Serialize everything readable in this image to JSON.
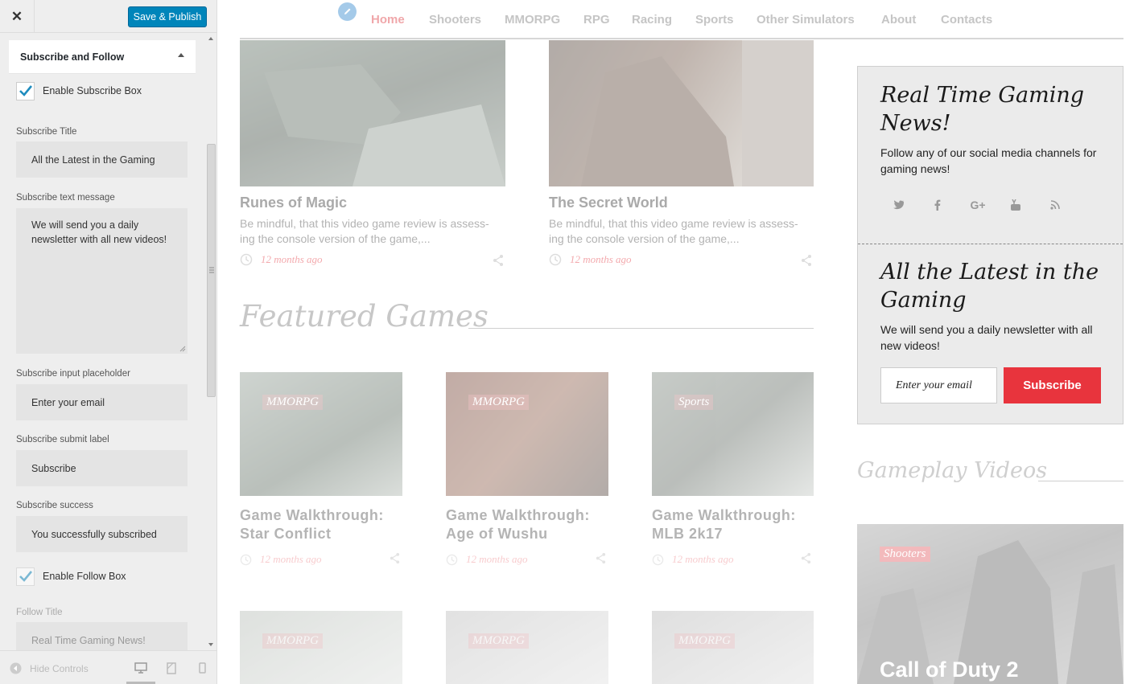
{
  "panel": {
    "close_symbol": "✕",
    "publish_label": "Save & Publish",
    "section_title": "Subscribe and Follow",
    "enable_subscribe_label": "Enable Subscribe Box",
    "enable_subscribe_checked": true,
    "fields": {
      "subscribe_title_label": "Subscribe Title",
      "subscribe_title_value": "All the Latest in the Gaming",
      "subscribe_text_label": "Subscribe text message",
      "subscribe_text_value": "We will send you a daily newsletter with all new videos!",
      "subscribe_placeholder_label": "Subscribe input placeholder",
      "subscribe_placeholder_value": "Enter your email",
      "subscribe_submit_label": "Subscribe submit label",
      "subscribe_submit_value": "Subscribe",
      "subscribe_success_label": "Subscribe success",
      "subscribe_success_value": "You successfully subscribed",
      "follow_title_label": "Follow Title",
      "follow_title_value": "Real Time Gaming News!"
    },
    "enable_follow_label": "Enable Follow Box",
    "enable_follow_checked": true,
    "footer": {
      "hide_controls_label": "Hide Controls",
      "devices": [
        "desktop-icon",
        "tablet-icon",
        "mobile-icon"
      ]
    }
  },
  "preview": {
    "nav": {
      "items": [
        "Home",
        "Shooters",
        "MMORPG",
        "RPG",
        "Racing",
        "Sports",
        "Other Simulators",
        "About",
        "Contacts"
      ],
      "active": "Home"
    },
    "top_posts": [
      {
        "title": "Runes of Magic",
        "excerpt": "Be mindful, that this video game review is assess-ing the console version of the game,...",
        "time": "12 months ago"
      },
      {
        "title": "The Secret World",
        "excerpt": "Be mindful, that this video game review is assess-ing the console version of the game,...",
        "time": "12 months ago"
      }
    ],
    "featured_title": "Featured Games",
    "featured": [
      {
        "badge": "MMORPG",
        "title": "Game Walkthrough: Star Conflict",
        "time": "12 months ago"
      },
      {
        "badge": "MMORPG",
        "title": "Game Walkthrough: Age of Wushu",
        "time": "12 months ago"
      },
      {
        "badge": "Sports",
        "title": "Game Walkthrough: MLB 2k17",
        "time": "12 months ago"
      }
    ],
    "bottom_badges": [
      "MMORPG",
      "MMORPG",
      "MMORPG"
    ],
    "widget": {
      "follow_title": "Real Time Gaming News!",
      "follow_text": "Follow any of our social media channels for gaming news!",
      "social_icons": [
        "twitter-icon",
        "facebook-icon",
        "google-plus-icon",
        "youtube-icon",
        "rss-icon"
      ],
      "subscribe_title": "All the Latest in the Gaming",
      "subscribe_text": "We will send you a daily newsletter with all new videos!",
      "email_placeholder": "Enter your email",
      "submit_label": "Subscribe"
    },
    "gameplay_title": "Gameplay Videos",
    "gameplay_card": {
      "badge": "Shooters",
      "title": "Call of Duty 2"
    },
    "colors": {
      "accent": "#e8343d",
      "publish": "#0085ba",
      "check": "#1e8cbe"
    }
  }
}
